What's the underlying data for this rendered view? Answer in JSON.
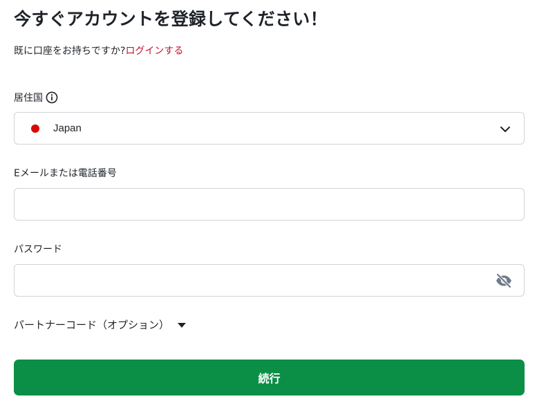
{
  "header": {
    "title": "今すぐアカウントを登録してください！",
    "subtitle_text": "既に口座をお持ちですか?",
    "login_link": "ログインする"
  },
  "residence": {
    "label": "居住国",
    "info_icon": "info-icon",
    "selected_country": "Japan",
    "flag_color": "#d60a0a",
    "dropdown_icon": "chevron-down-icon"
  },
  "email": {
    "label": "Eメールまたは電話番号",
    "value": "",
    "placeholder": ""
  },
  "password": {
    "label": "パスワード",
    "value": "",
    "placeholder": "",
    "toggle_icon": "eye-off-icon"
  },
  "partner_code": {
    "label": "パートナーコード（オプション）",
    "toggle_icon": "caret-down-icon"
  },
  "actions": {
    "continue_label": "続行"
  },
  "colors": {
    "accent_link": "#c0152f",
    "primary_button": "#0b8f46",
    "border": "#cfd3d8",
    "text": "#1e2329"
  }
}
